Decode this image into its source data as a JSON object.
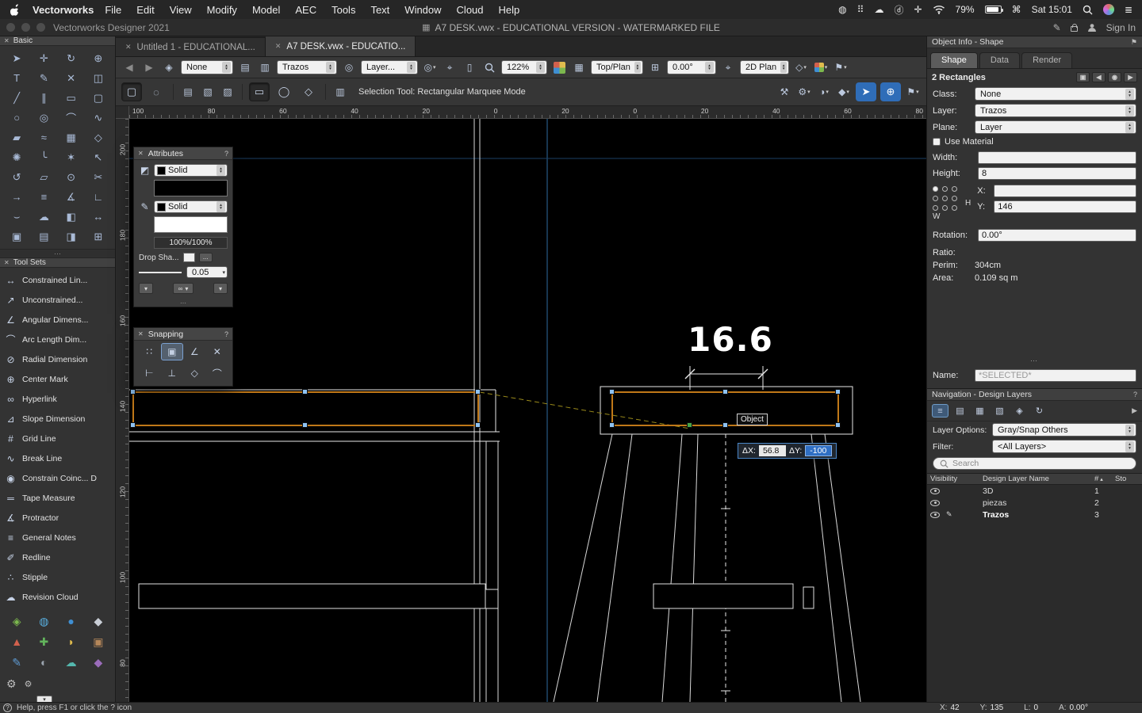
{
  "icons": {
    "close": "✕",
    "help": "?",
    "flag": "⚑",
    "gear": "⚙",
    "gear_small": "⚙",
    "back": "◀",
    "forward": "▶",
    "caret_down": "▾",
    "caret_up": "▴",
    "saved_views": "◈",
    "layers": "▤",
    "layers_alt": "▥",
    "compass": "◎",
    "plane_mode": "▦",
    "origin": "⌖",
    "page": "▯",
    "cube": "◇",
    "wrench": "⚒",
    "paint": "◑",
    "shapes": "◆",
    "cursor": "➤",
    "target": "⊕",
    "marquee": "▢",
    "lasso": "◌",
    "group_a": "▤",
    "group_b": "▧",
    "group_c": "▨",
    "column": "▥",
    "rect": "▭",
    "oval": "◯",
    "poly": "◇",
    "bucket": "◩",
    "pen": "✎",
    "link": "∞",
    "dots": "⋯",
    "pencil": "✎",
    "prev": "◀",
    "next": "▶",
    "pin": "◉",
    "multi": "▣",
    "menu_circle": "◍",
    "menu_grid": "⠿",
    "menu_cloud": "☁",
    "menu_d": "ⓓ",
    "menu_plus": "✛",
    "menu_cmd": "⌘",
    "menu_list": "≣",
    "hierarchy": "≡",
    "ref": "↻",
    "sheet": "▦",
    "classes": "▧",
    "vp": "⊞",
    "sort_up": "▴",
    "doc": "▦"
  },
  "menubar": {
    "app_name": "Vectorworks",
    "menus": [
      "File",
      "Edit",
      "View",
      "Modify",
      "Model",
      "AEC",
      "Tools",
      "Text",
      "Window",
      "Cloud",
      "Help"
    ],
    "battery": "79%",
    "clock": "Sat 15:01"
  },
  "titlebar": {
    "app_title": "Vectorworks Designer 2021",
    "doc_title": "A7 DESK.vwx - EDUCATIONAL VERSION - WATERMARKED FILE",
    "sign_in": "Sign In"
  },
  "tabs": [
    {
      "label": "Untitled 1 - EDUCATIONAL...",
      "active": false
    },
    {
      "label": "A7 DESK.vwx - EDUCATIO...",
      "active": true
    }
  ],
  "toolbar": {
    "class_value": "None",
    "layer_value": "Trazos",
    "view_value": "Layer...",
    "zoom_value": "122%",
    "projection_value": "Top/Plan",
    "angle_value": "0.00°",
    "plan_value": "2D Plan",
    "status_text": "Selection Tool: Rectangular Marquee Mode"
  },
  "basic_palette": {
    "title": "Basic",
    "tools": [
      {
        "glyph": "➤",
        "name": "selection-tool"
      },
      {
        "glyph": "✛",
        "name": "pan-tool"
      },
      {
        "glyph": "↻",
        "name": "flyover-tool"
      },
      {
        "glyph": "⊕",
        "name": "zoom-tool"
      },
      {
        "glyph": "T",
        "name": "text-tool"
      },
      {
        "glyph": "✎",
        "name": "callout-tool"
      },
      {
        "glyph": "✕",
        "name": "eyedropper-tool"
      },
      {
        "glyph": "◫",
        "name": "mirror-tool"
      },
      {
        "glyph": "╱",
        "name": "line-tool"
      },
      {
        "glyph": "∥",
        "name": "double-line-tool"
      },
      {
        "glyph": "▭",
        "name": "rectangle-tool"
      },
      {
        "glyph": "▢",
        "name": "rounded-rectangle-tool"
      },
      {
        "glyph": "○",
        "name": "circle-tool"
      },
      {
        "glyph": "◎",
        "name": "oval-tool"
      },
      {
        "glyph": "⌒",
        "name": "arc-tool"
      },
      {
        "glyph": "∿",
        "name": "freehand-tool"
      },
      {
        "glyph": "▰",
        "name": "polygon-tool"
      },
      {
        "glyph": "≈",
        "name": "polyline-tool"
      },
      {
        "glyph": "▦",
        "name": "surface-tool"
      },
      {
        "glyph": "◇",
        "name": "regular-polygon-tool"
      },
      {
        "glyph": "✺",
        "name": "spiral-tool"
      },
      {
        "glyph": "╰",
        "name": "fillet-tool"
      },
      {
        "glyph": "✶",
        "name": "star-tool"
      },
      {
        "glyph": "↖",
        "name": "lasso-tool"
      },
      {
        "glyph": "↺",
        "name": "rotate-tool"
      },
      {
        "glyph": "▱",
        "name": "shear-tool"
      },
      {
        "glyph": "⊙",
        "name": "wheel-tool"
      },
      {
        "glyph": "✂",
        "name": "split-tool"
      },
      {
        "glyph": "→",
        "name": "move-by-points-tool"
      },
      {
        "glyph": "≡",
        "name": "offset-tool"
      },
      {
        "glyph": "∡",
        "name": "protractor-tool"
      },
      {
        "glyph": "∟",
        "name": "corner-tool"
      },
      {
        "glyph": "⌣",
        "name": "arc-by-points-tool"
      },
      {
        "glyph": "☁",
        "name": "cloud-tool"
      },
      {
        "glyph": "◧",
        "name": "extrude-tool"
      },
      {
        "glyph": "↔",
        "name": "dimension-tool"
      },
      {
        "glyph": "▣",
        "name": "viewport-tool"
      },
      {
        "glyph": "▤",
        "name": "clip-tool"
      },
      {
        "glyph": "◨",
        "name": "section-tool"
      },
      {
        "glyph": "⊞",
        "name": "grid-tool"
      }
    ]
  },
  "toolsets_palette": {
    "title": "Tool Sets",
    "items": [
      {
        "glyph": "↔",
        "label": "Constrained Lin...",
        "name": "constrained-linear-dimension-tool"
      },
      {
        "glyph": "↗",
        "label": "Unconstrained...",
        "name": "unconstrained-linear-dimension-tool"
      },
      {
        "glyph": "∠",
        "label": "Angular Dimens...",
        "name": "angular-dimension-tool"
      },
      {
        "glyph": "⌒",
        "label": "Arc Length Dim...",
        "name": "arc-length-dimension-tool"
      },
      {
        "glyph": "⊘",
        "label": "Radial Dimension",
        "name": "radial-dimension-tool"
      },
      {
        "glyph": "⊕",
        "label": "Center Mark",
        "name": "center-mark-tool"
      },
      {
        "glyph": "∞",
        "label": "Hyperlink",
        "name": "hyperlink-tool"
      },
      {
        "glyph": "⊿",
        "label": "Slope Dimension",
        "name": "slope-dimension-tool"
      },
      {
        "glyph": "#",
        "label": "Grid Line",
        "name": "grid-line-tool"
      },
      {
        "glyph": "∿",
        "label": "Break Line",
        "name": "break-line-tool"
      },
      {
        "glyph": "◉",
        "label": "Constrain Coinc... D",
        "name": "constrain-coincident-tool"
      },
      {
        "glyph": "═",
        "label": "Tape Measure",
        "name": "tape-measure-tool"
      },
      {
        "glyph": "∡",
        "label": "Protractor",
        "name": "protractor-toolset-tool"
      },
      {
        "glyph": "≡",
        "label": "General Notes",
        "name": "general-notes-tool"
      },
      {
        "glyph": "✐",
        "label": "Redline",
        "name": "redline-tool"
      },
      {
        "glyph": "∴",
        "label": "Stipple",
        "name": "stipple-tool"
      },
      {
        "glyph": "☁",
        "label": "Revision Cloud",
        "name": "revision-cloud-tool"
      }
    ],
    "sets": [
      {
        "glyph": "◈",
        "color": "#7cb84e",
        "name": "toolset-category-1"
      },
      {
        "glyph": "◍",
        "color": "#58aede",
        "name": "toolset-category-2"
      },
      {
        "glyph": "●",
        "color": "#3f8fd2",
        "name": "toolset-category-3"
      },
      {
        "glyph": "◆",
        "color": "#c9ced6",
        "name": "toolset-category-4"
      },
      {
        "glyph": "▲",
        "color": "#d2614d",
        "name": "toolset-category-5"
      },
      {
        "glyph": "✚",
        "color": "#62b45c",
        "name": "toolset-category-6"
      },
      {
        "glyph": "◗",
        "color": "#e0bc4e",
        "name": "toolset-category-7"
      },
      {
        "glyph": "▣",
        "color": "#b5875a",
        "name": "toolset-category-8"
      },
      {
        "glyph": "✎",
        "color": "#5e9ad2",
        "name": "toolset-category-9"
      },
      {
        "glyph": "◐",
        "color": "#9aa3ad",
        "name": "toolset-category-10"
      },
      {
        "glyph": "☁",
        "color": "#54b8ae",
        "name": "toolset-category-11"
      },
      {
        "glyph": "◆",
        "color": "#9a6cba",
        "name": "toolset-category-12"
      }
    ]
  },
  "attributes_palette": {
    "title": "Attributes",
    "fill_style": "Solid",
    "pen_style": "Solid",
    "opacity": "100%/100%",
    "drop_shadow": "Drop Sha...",
    "more": "...",
    "line_weight": "0.05"
  },
  "snapping_palette": {
    "title": "Snapping",
    "row1": [
      {
        "glyph": "∷",
        "name": "grid-snap-toggle",
        "active": false
      },
      {
        "glyph": "▣",
        "name": "object-snap-toggle",
        "active": true
      },
      {
        "glyph": "∠",
        "name": "angle-snap-toggle",
        "active": false
      },
      {
        "glyph": "✕",
        "name": "intersection-snap-toggle",
        "active": false
      }
    ],
    "row2": [
      {
        "glyph": "⊢",
        "name": "distance-snap-toggle",
        "active": false
      },
      {
        "glyph": "⊥",
        "name": "tangent-snap-toggle",
        "active": false
      },
      {
        "glyph": "◇",
        "name": "smart-point-snap-toggle",
        "active": false
      },
      {
        "glyph": "⌒",
        "name": "smart-edge-snap-toggle",
        "active": false
      }
    ]
  },
  "rulers": {
    "top": [
      "100",
      "80",
      "60",
      "40",
      "20",
      "0",
      "20",
      "0",
      "20",
      "40",
      "60",
      "80"
    ],
    "left": [
      "200",
      "180",
      "160",
      "140",
      "120",
      "100",
      "80"
    ]
  },
  "canvas": {
    "dimension_text": "16.6",
    "tooltip": "Object",
    "databar": {
      "dx_label": "ΔX:",
      "dx_value": "56.8",
      "dy_label": "ΔY:",
      "dy_value": "-100"
    }
  },
  "object_info": {
    "title": "Object Info - Shape",
    "tabs": [
      {
        "label": "Shape",
        "active": true
      },
      {
        "label": "Data",
        "active": false
      },
      {
        "label": "Render",
        "active": false
      }
    ],
    "selection_summary": "2 Rectangles",
    "class_label": "Class:",
    "class_value": "None",
    "layer_label": "Layer:",
    "layer_value": "Trazos",
    "plane_label": "Plane:",
    "plane_value": "Layer",
    "use_material_label": "Use Material",
    "width_label": "Width:",
    "width_value": "",
    "height_label": "Height:",
    "height_value": "8",
    "h_label": "H",
    "w_label": "W",
    "x_label": "X:",
    "x_value": "",
    "y_label": "Y:",
    "y_value": "146",
    "rotation_label": "Rotation:",
    "rotation_value": "0.00°",
    "ratio_label": "Ratio:",
    "perim_label": "Perim:",
    "perim_value": "304cm",
    "area_label": "Area:",
    "area_value": "0.109 sq m",
    "name_label": "Name:",
    "name_value": "*SELECTED*"
  },
  "navigation": {
    "title": "Navigation - Design Layers",
    "layer_options_label": "Layer Options:",
    "layer_options_value": "Gray/Snap Others",
    "filter_label": "Filter:",
    "filter_value": "<All Layers>",
    "search_placeholder": "Search",
    "columns": {
      "visibility": "Visibility",
      "name": "Design Layer Name",
      "number": "#",
      "stories": "Sto"
    },
    "layers": [
      {
        "name": "3D",
        "number": "1",
        "active": false
      },
      {
        "name": "piezas",
        "number": "2",
        "active": false
      },
      {
        "name": "Trazos",
        "number": "3",
        "active": true
      }
    ]
  },
  "statusbar": {
    "help_text": "Help, press F1 or click the ? icon",
    "x_label": "X:",
    "x_value": "42",
    "y_label": "Y:",
    "y_value": "135",
    "l_label": "L:",
    "l_value": "0",
    "a_label": "A:",
    "a_value": "0.00°"
  }
}
